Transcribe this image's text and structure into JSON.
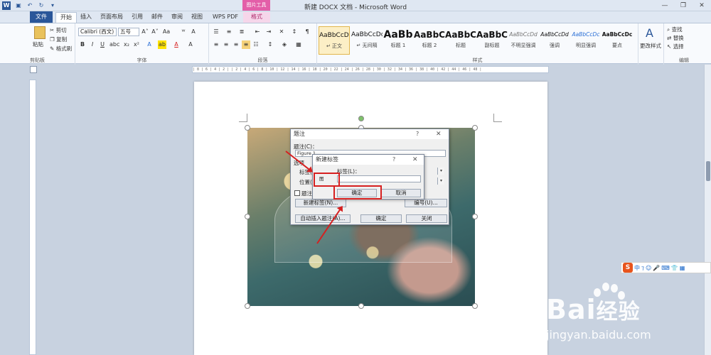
{
  "window": {
    "title": "新建 DOCX 文档 - Microsoft Word",
    "context_group": "图片工具",
    "app_icon": "W"
  },
  "tabs": {
    "file": "文件",
    "home": "开始",
    "insert": "插入",
    "layout": "页面布局",
    "references": "引用",
    "mailings": "邮件",
    "review": "审阅",
    "view": "视图",
    "wps_pdf": "WPS PDF",
    "format": "格式"
  },
  "clipboard": {
    "paste": "粘贴",
    "cut": "剪切",
    "copy": "复制",
    "painter": "格式刷",
    "group": "剪贴板"
  },
  "font": {
    "name": "Calibri (西文)",
    "size": "五号",
    "group": "字体"
  },
  "paragraph": {
    "group": "段落"
  },
  "styles": {
    "group": "样式",
    "items": [
      {
        "sample": "AaBbCcDd",
        "name": "↵ 正文"
      },
      {
        "sample": "AaBbCcDd",
        "name": "↵ 无间隔"
      },
      {
        "sample": "AaBb",
        "name": "标题 1"
      },
      {
        "sample": "AaBbC",
        "name": "标题 2"
      },
      {
        "sample": "AaBbC",
        "name": "标题"
      },
      {
        "sample": "AaBbC",
        "name": "副标题"
      },
      {
        "sample": "AaBbCcDd",
        "name": "不明显强调"
      },
      {
        "sample": "AaBbCcDd",
        "name": "强调"
      },
      {
        "sample": "AaBbCcDc",
        "name": "明显强调"
      },
      {
        "sample": "AaBbCcDc",
        "name": "要点"
      }
    ],
    "change": "更改样式"
  },
  "editing": {
    "find": "查找",
    "replace": "替换",
    "select": "选择",
    "group": "编辑"
  },
  "ruler": {
    "ticks": "| 8 | 6 | 4 | 2 |   | 2 | 4 | 6 | 8 | 10 | 12 | 14 | 16 | 18 | 20 | 22 | 24 | 26 | 28 | 30 | 32 | 34 | 36 | 38 | 40 | 42 | 44 | 46 | 48 |"
  },
  "caption_dialog": {
    "title": "题注",
    "help": "?",
    "caption_label": "题注(C)：",
    "caption_value": "Figure 1",
    "options_label": "选项",
    "label_label": "标签(",
    "position_label": "位置(",
    "exclude_label": "题注",
    "new_label_button": "新建标签(N)...",
    "numbering_button": "编号(U)...",
    "auto_button": "自动插入题注(A)...",
    "ok": "确定",
    "close": "关闭"
  },
  "new_label_dialog": {
    "title": "新建标签",
    "help": "?",
    "label_label": "标签(L)：",
    "label_value": "图",
    "ok": "确定",
    "cancel": "取消"
  },
  "ime": {
    "lang": "中"
  },
  "watermark": {
    "brand": "Bai",
    "brand_cn": "经验",
    "site": "jingyan.baidu.com"
  },
  "colors": {
    "accent": "#2a5699",
    "highlight": "#d62020",
    "context": "#e35ea8"
  }
}
